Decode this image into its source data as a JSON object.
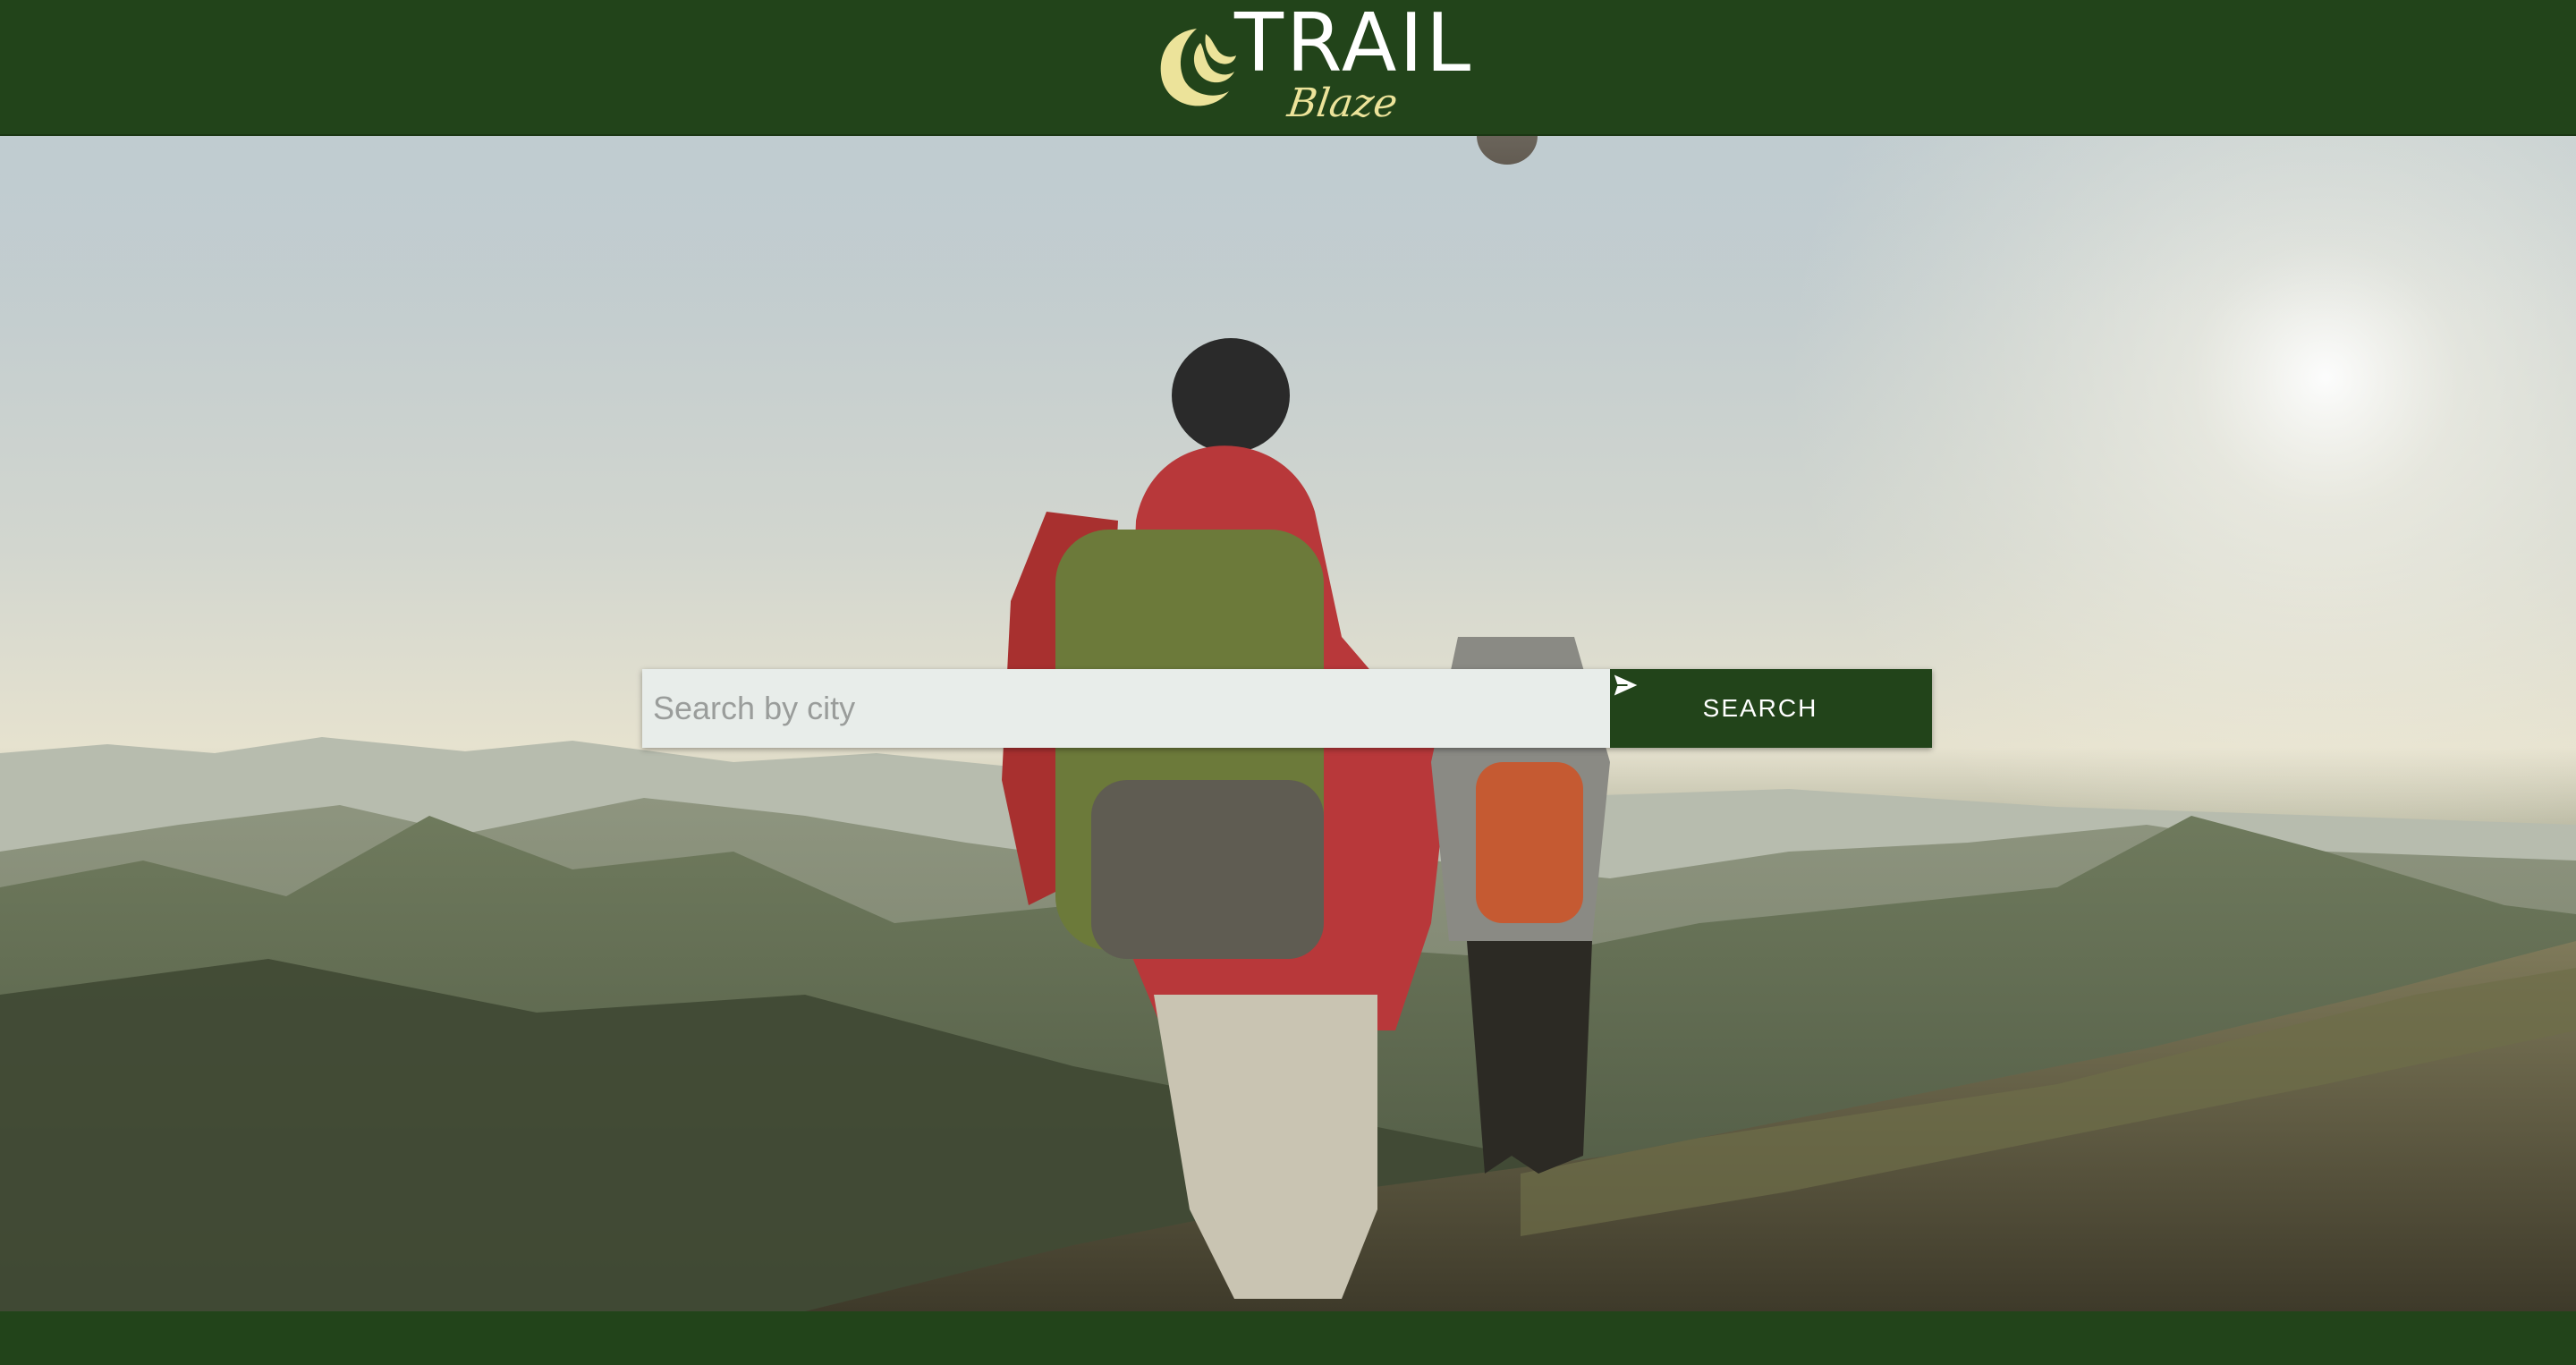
{
  "header": {
    "logo_word": "TRAIL",
    "logo_sub": "Blaze"
  },
  "search": {
    "placeholder": "Search by city",
    "value": "",
    "button_label": "SEARCH"
  },
  "icons": {
    "logo": "crescent-moon-icon",
    "submit": "send-icon"
  },
  "colors": {
    "brand_green": "#22441a",
    "logo_accent": "#ece39a",
    "input_bg": "#e8edea"
  }
}
